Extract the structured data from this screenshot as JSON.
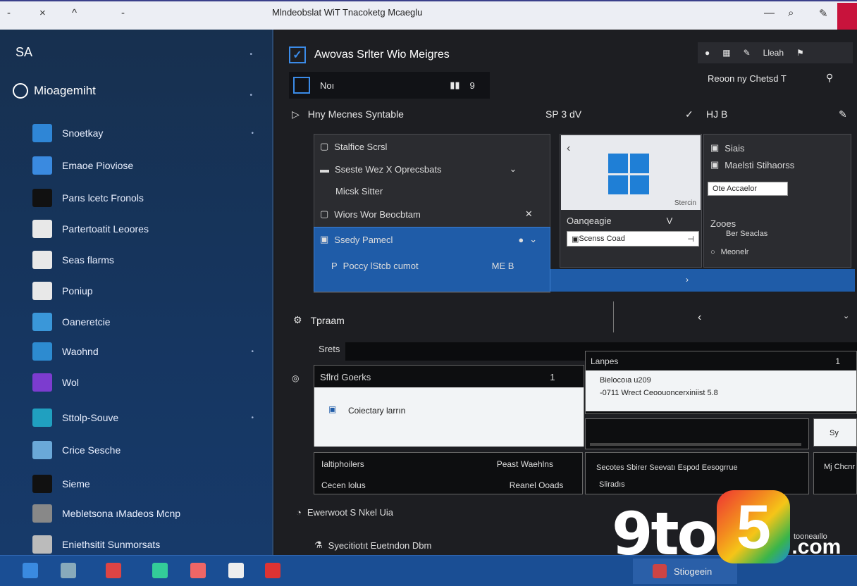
{
  "titlebar": {
    "title": "Mlndeobslat WiT Tnacoketg Mcaeglu",
    "left_icons": [
      "×",
      "^",
      "-"
    ],
    "right_icons": [
      "—",
      "🔍",
      "✎"
    ]
  },
  "sidebar": {
    "top": "SA",
    "management": "Mioagemiht",
    "items": [
      {
        "label": "Snoetkay",
        "color": "#2f86d6"
      },
      {
        "label": "Emaoe Pioviose",
        "color": "#3a8ae0"
      },
      {
        "label": "Parıs lcetc Fronols",
        "color": "#111"
      },
      {
        "label": "Partertoatit Leoores",
        "color": "#e8e8e8"
      },
      {
        "label": "Seas flarms",
        "color": "#e8e8e8"
      },
      {
        "label": "Poniup",
        "color": "#e8e8e8"
      },
      {
        "label": "Oaneretcie",
        "color": "#3a97d9"
      },
      {
        "label": "Waohnd",
        "color": "#2d8bd0"
      },
      {
        "label": "Wol",
        "color": "#7c3ccf"
      },
      {
        "label": "Sttolp-Souve",
        "color": "#20a0c0"
      },
      {
        "label": "Crice Sesche",
        "color": "#6aa8d8"
      },
      {
        "label": "Sieme",
        "color": "#111"
      },
      {
        "label": "Mebletsona ıMadeos Mcnp",
        "color": "#888"
      },
      {
        "label": "Eniethsitit Sunmorsats",
        "color": "#bbb"
      }
    ]
  },
  "main": {
    "header": "Awovas Srlter Wio Meigres",
    "toolbar": "Lleah",
    "recent": "Reoon ny Chetsd T",
    "picker": {
      "label": "Noı",
      "num": "9"
    },
    "row_title": "Hny Mecnes Syntable",
    "row_icons": "SP 3 dV",
    "row_right": "HJ B",
    "list": [
      "Stalfice Scrsl",
      "Sseste Wez X Oprecsbats",
      "Micsk Sitter",
      "Wiors Wor Beocbtam"
    ],
    "selected": "Ssedy Pamecl",
    "selected_sub": "Poccy lStcb cumot",
    "selected_sub_r": "ME B",
    "winbox_caption": "Stercin",
    "win_sub": "Oanqeagie",
    "win_input": "Scenss Coad",
    "right": {
      "a": "Siais",
      "b": "Maelsti Stihaorss",
      "input": "Ote Accaelor",
      "c": "Zooes",
      "d": "Ber Seaclas",
      "e": "Meonelr"
    },
    "sec2_title": "Tpraam",
    "streets": "Srets",
    "card1_title": "Sflrd Goerks",
    "card1_num": "1",
    "card1_body": "Coiectary larrın",
    "card2_title": "Lanpes",
    "card2_num": "1",
    "card2_l1": "Bielocoıa u209",
    "card2_l2": "-0711 Wrect Ceoouoncerxiniist 5.8",
    "bottom_l1": "Ialtiphoilers",
    "bottom_r1": "Peast Waehlns",
    "bottom_l2": "Cecen lolus",
    "bottom_r2": "Reanel Ooads",
    "bottom_m1": "Secotes Sbirer Seevatı Espod Eesogrrue",
    "bottom_m2": "Sliradıs",
    "far_r1": "Sy",
    "far_r2": "Mj Chcnr",
    "foot1": "Ewerwoot S Nkel Uia",
    "foot2": "Syecitiotıt Euetndon Dbm",
    "foot3": "tooneaıllo"
  },
  "taskbar": {
    "label": "Stiogeein"
  },
  "logo": {
    "text1": "9to",
    "text2": "5",
    "text3": ".com"
  }
}
